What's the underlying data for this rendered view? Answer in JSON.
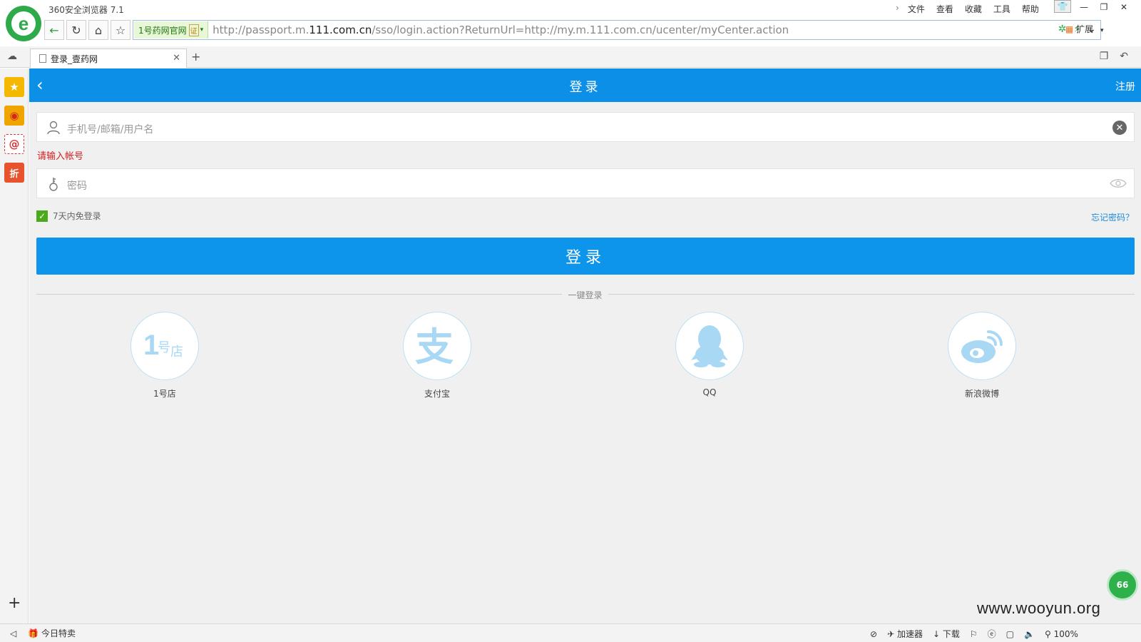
{
  "browser": {
    "app_title": "360安全浏览器 7.1",
    "menu": [
      "文件",
      "查看",
      "收藏",
      "工具",
      "帮助"
    ],
    "site_badge": "1号药网官网",
    "cert_label": "证",
    "url_prefix": "http://passport.m.",
    "url_domain": "111.com.cn",
    "url_suffix": "/sso/login.action?ReturnUrl=http://my.m.111.com.cn/ucenter/myCenter.action",
    "extensions_label": "扩展",
    "tab_title": "登录_壹药网",
    "sidebar_discount_label": "折"
  },
  "page": {
    "header": {
      "title": "登录",
      "register_label": "注册"
    },
    "username_placeholder": "手机号/邮箱/用户名",
    "username_error": "请输入帐号",
    "password_placeholder": "密码",
    "remember_label": "7天内免登录",
    "forgot_label": "忘记密码？",
    "login_button": "登录",
    "divider_label": "一键登录",
    "social": [
      {
        "label": "1号店",
        "icon": "yhd-icon"
      },
      {
        "label": "支付宝",
        "icon": "alipay-icon"
      },
      {
        "label": "QQ",
        "icon": "qq-icon"
      },
      {
        "label": "新浪微博",
        "icon": "weibo-icon"
      }
    ]
  },
  "statusbar": {
    "today_sale": "今日特卖",
    "accelerator": "加速器",
    "download": "下载",
    "zoom": "100%"
  },
  "watermark": "www.wooyun.org",
  "float_ball_text": "66",
  "colors": {
    "brand_blue": "#0c8fe6",
    "error_red": "#d21f1f",
    "check_green": "#4aaa1c"
  }
}
